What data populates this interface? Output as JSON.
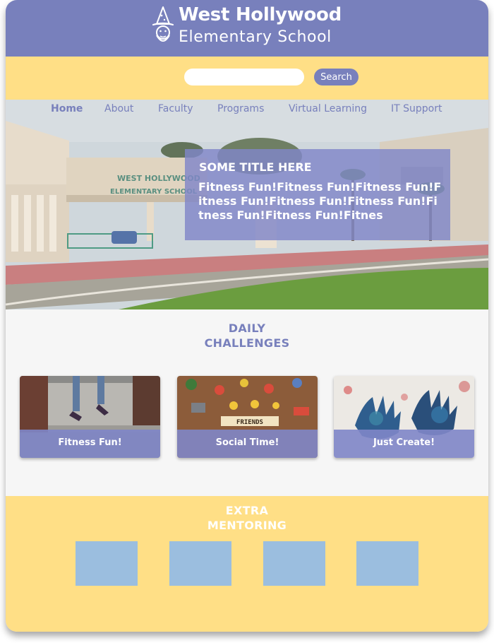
{
  "header": {
    "school_name_line1": "West Hollywood",
    "school_name_line2": "Elementary School",
    "logo_icon": "wizard-mascot-icon"
  },
  "search": {
    "placeholder": "",
    "value": "",
    "button_label": "Search"
  },
  "nav": {
    "items": [
      "Home",
      "About",
      "Faculty",
      "Programs",
      "Virtual Learning",
      "IT Support"
    ],
    "active": "Home"
  },
  "hero": {
    "title": "SOME TITLE HERE",
    "body": "Fitness Fun!Fitness Fun!Fitness Fun!Fitness Fun!Fitness Fun!Fitness Fun!Fitness Fun!Fitness Fun!Fitnes",
    "sign_line1": "WEST HOLLYWOOD",
    "sign_line2": "ELEMENTARY SCHOOL"
  },
  "daily": {
    "title_line1": "DAILY",
    "title_line2": "CHALLENGES",
    "cards": [
      {
        "label": "Fitness Fun!"
      },
      {
        "label": "Social Time!"
      },
      {
        "label": "Just Create!"
      }
    ],
    "scrabble_word": "FRIENDS"
  },
  "mentoring": {
    "title_line1": "EXTRA",
    "title_line2": "MENTORING",
    "tile_count": 4
  },
  "colors": {
    "primary": "#7880bc",
    "accent_yellow": "#ffdf86",
    "tile_blue": "#9bbedf",
    "page_bg": "#f6f6f6"
  }
}
